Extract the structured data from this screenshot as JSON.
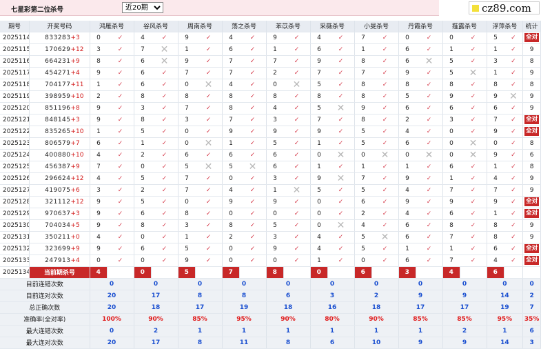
{
  "header": {
    "title": "七星彩第二位杀号",
    "range_select": "近20期"
  },
  "logo": {
    "text": "cz89.com"
  },
  "columns": {
    "period": "期号",
    "draw": "开奖号码",
    "experts": [
      "鸿雁杀号",
      "谷风杀号",
      "周南杀号",
      "荡之杀号",
      "苯苡杀号",
      "采薇杀号",
      "小旻杀号",
      "丹霞杀号",
      "薤露杀号",
      "浮萍杀号"
    ],
    "stat": "统计"
  },
  "rows": [
    {
      "period": "2025114",
      "draw": "833283",
      "sum": "+3",
      "k": [
        0,
        4,
        9,
        4,
        9,
        4,
        7,
        0,
        0,
        5
      ],
      "r": [
        "o",
        "o",
        "o",
        "o",
        "o",
        "o",
        "o",
        "o",
        "o",
        "o"
      ],
      "stat": "全对"
    },
    {
      "period": "2025115",
      "draw": "170629",
      "sum": "+12",
      "k": [
        3,
        7,
        1,
        6,
        1,
        6,
        1,
        6,
        1,
        1
      ],
      "r": [
        "o",
        "x",
        "o",
        "o",
        "o",
        "o",
        "o",
        "o",
        "o",
        "o"
      ],
      "stat": "9"
    },
    {
      "period": "2025116",
      "draw": "664231",
      "sum": "+9",
      "k": [
        8,
        6,
        9,
        7,
        7,
        9,
        8,
        6,
        5,
        3
      ],
      "r": [
        "o",
        "x",
        "o",
        "o",
        "o",
        "o",
        "o",
        "x",
        "o",
        "o"
      ],
      "stat": "8"
    },
    {
      "period": "2025117",
      "draw": "454271",
      "sum": "+4",
      "k": [
        9,
        6,
        7,
        7,
        2,
        7,
        7,
        9,
        5,
        1
      ],
      "r": [
        "o",
        "o",
        "o",
        "o",
        "o",
        "o",
        "o",
        "o",
        "x",
        "o"
      ],
      "stat": "9"
    },
    {
      "period": "2025118",
      "draw": "704177",
      "sum": "+11",
      "k": [
        1,
        6,
        0,
        4,
        0,
        5,
        8,
        8,
        8,
        8
      ],
      "r": [
        "o",
        "o",
        "x",
        "o",
        "x",
        "o",
        "o",
        "o",
        "o",
        "o"
      ],
      "stat": "8"
    },
    {
      "period": "2025119",
      "draw": "398959",
      "sum": "+10",
      "k": [
        2,
        8,
        8,
        8,
        8,
        8,
        8,
        5,
        9,
        9
      ],
      "r": [
        "o",
        "o",
        "o",
        "o",
        "o",
        "o",
        "o",
        "o",
        "o",
        "x"
      ],
      "stat": "9"
    },
    {
      "period": "2025120",
      "draw": "851196",
      "sum": "+8",
      "k": [
        9,
        3,
        7,
        8,
        4,
        5,
        9,
        6,
        6,
        6
      ],
      "r": [
        "o",
        "o",
        "o",
        "o",
        "o",
        "x",
        "o",
        "o",
        "o",
        "o"
      ],
      "stat": "9"
    },
    {
      "period": "2025121",
      "draw": "848145",
      "sum": "+3",
      "k": [
        9,
        8,
        3,
        7,
        3,
        7,
        8,
        2,
        3,
        7
      ],
      "r": [
        "o",
        "o",
        "o",
        "o",
        "o",
        "o",
        "o",
        "o",
        "o",
        "o"
      ],
      "stat": "全对"
    },
    {
      "period": "2025122",
      "draw": "835265",
      "sum": "+10",
      "k": [
        1,
        5,
        0,
        9,
        9,
        9,
        5,
        4,
        0,
        9
      ],
      "r": [
        "o",
        "o",
        "o",
        "o",
        "o",
        "o",
        "o",
        "o",
        "o",
        "o"
      ],
      "stat": "全对"
    },
    {
      "period": "2025123",
      "draw": "806579",
      "sum": "+7",
      "k": [
        6,
        1,
        0,
        1,
        5,
        1,
        5,
        6,
        0,
        0
      ],
      "r": [
        "o",
        "o",
        "x",
        "o",
        "o",
        "o",
        "o",
        "o",
        "x",
        "o"
      ],
      "stat": "8"
    },
    {
      "period": "2025124",
      "draw": "400880",
      "sum": "+10",
      "k": [
        4,
        2,
        6,
        6,
        6,
        0,
        0,
        0,
        0,
        9
      ],
      "r": [
        "o",
        "o",
        "o",
        "o",
        "o",
        "x",
        "x",
        "x",
        "x",
        "o"
      ],
      "stat": "6"
    },
    {
      "period": "2025125",
      "draw": "456387",
      "sum": "+9",
      "k": [
        7,
        0,
        5,
        5,
        6,
        1,
        1,
        1,
        6,
        1
      ],
      "r": [
        "o",
        "o",
        "x",
        "x",
        "o",
        "o",
        "o",
        "o",
        "o",
        "o"
      ],
      "stat": "8"
    },
    {
      "period": "2025126",
      "draw": "296624",
      "sum": "+12",
      "k": [
        4,
        5,
        7,
        0,
        3,
        9,
        7,
        9,
        1,
        4
      ],
      "r": [
        "o",
        "o",
        "o",
        "o",
        "o",
        "x",
        "o",
        "o",
        "o",
        "o"
      ],
      "stat": "9"
    },
    {
      "period": "2025127",
      "draw": "419075",
      "sum": "+6",
      "k": [
        3,
        2,
        7,
        4,
        1,
        5,
        5,
        4,
        7,
        7
      ],
      "r": [
        "o",
        "o",
        "o",
        "o",
        "x",
        "o",
        "o",
        "o",
        "o",
        "o"
      ],
      "stat": "9"
    },
    {
      "period": "2025128",
      "draw": "321112",
      "sum": "+12",
      "k": [
        9,
        5,
        0,
        9,
        9,
        0,
        6,
        9,
        9,
        9
      ],
      "r": [
        "o",
        "o",
        "o",
        "o",
        "o",
        "o",
        "o",
        "o",
        "o",
        "o"
      ],
      "stat": "全对"
    },
    {
      "period": "2025129",
      "draw": "970637",
      "sum": "+3",
      "k": [
        9,
        6,
        8,
        0,
        0,
        0,
        2,
        4,
        6,
        1
      ],
      "r": [
        "o",
        "o",
        "o",
        "o",
        "o",
        "o",
        "o",
        "o",
        "o",
        "o"
      ],
      "stat": "全对"
    },
    {
      "period": "2025130",
      "draw": "704034",
      "sum": "+5",
      "k": [
        9,
        8,
        3,
        8,
        5,
        0,
        4,
        6,
        8,
        8
      ],
      "r": [
        "o",
        "o",
        "o",
        "o",
        "o",
        "x",
        "o",
        "o",
        "o",
        "o"
      ],
      "stat": "9"
    },
    {
      "period": "2025131",
      "draw": "350211",
      "sum": "+0",
      "k": [
        4,
        0,
        1,
        2,
        3,
        4,
        5,
        6,
        7,
        8
      ],
      "r": [
        "o",
        "o",
        "o",
        "o",
        "o",
        "o",
        "x",
        "o",
        "o",
        "o"
      ],
      "stat": "9"
    },
    {
      "period": "2025132",
      "draw": "323699",
      "sum": "+9",
      "k": [
        9,
        6,
        5,
        0,
        9,
        4,
        5,
        1,
        1,
        6
      ],
      "r": [
        "o",
        "o",
        "o",
        "o",
        "o",
        "o",
        "o",
        "o",
        "o",
        "o"
      ],
      "stat": "全对"
    },
    {
      "period": "2025133",
      "draw": "247913",
      "sum": "+4",
      "k": [
        0,
        0,
        9,
        0,
        0,
        1,
        0,
        6,
        7,
        4
      ],
      "r": [
        "o",
        "o",
        "o",
        "o",
        "o",
        "o",
        "o",
        "o",
        "o",
        "o"
      ],
      "stat": "全对"
    }
  ],
  "current": {
    "period": "2025134",
    "label": "当前期杀号",
    "k": [
      4,
      0,
      5,
      7,
      8,
      0,
      6,
      3,
      4,
      6
    ]
  },
  "stats": [
    {
      "label": "目前连错次数",
      "v": [
        0,
        0,
        0,
        0,
        0,
        0,
        0,
        0,
        0,
        0,
        0
      ]
    },
    {
      "label": "目前连对次数",
      "v": [
        20,
        17,
        8,
        8,
        6,
        3,
        2,
        9,
        9,
        14,
        2
      ]
    },
    {
      "label": "总正确次数",
      "v": [
        20,
        18,
        17,
        19,
        18,
        16,
        18,
        17,
        17,
        19,
        7
      ]
    },
    {
      "label": "准确率(全对率)",
      "v": [
        "100%",
        "90%",
        "85%",
        "95%",
        "90%",
        "80%",
        "90%",
        "85%",
        "85%",
        "95%",
        "35%"
      ],
      "rate": true
    },
    {
      "label": "最大连错次数",
      "v": [
        0,
        2,
        1,
        1,
        1,
        1,
        1,
        1,
        2,
        1,
        6
      ]
    },
    {
      "label": "最大连对次数",
      "v": [
        20,
        17,
        8,
        11,
        8,
        6,
        10,
        9,
        9,
        14,
        3
      ]
    }
  ],
  "colors": {
    "hit": "#d53b4b",
    "miss": "#b8b8b8",
    "full": "#c82828",
    "stat_blue": "#1a4fd0"
  }
}
